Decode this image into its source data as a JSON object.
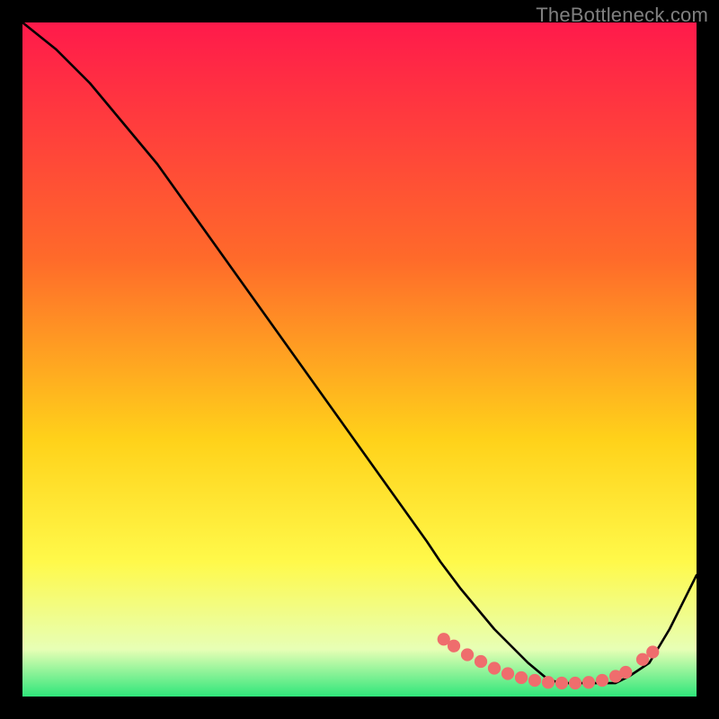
{
  "watermark": "TheBottleneck.com",
  "colors": {
    "bg_black": "#000000",
    "grad_top": "#ff1a4b",
    "grad_mid1": "#ff6a2a",
    "grad_mid2": "#ffd21a",
    "grad_mid3": "#fff94a",
    "grad_mid4": "#e7ffb5",
    "grad_bottom": "#2fe67a",
    "curve": "#000000",
    "dots": "#ef6d6d"
  },
  "chart_data": {
    "type": "line",
    "title": "",
    "xlabel": "",
    "ylabel": "",
    "xlim": [
      0,
      100
    ],
    "ylim": [
      0,
      100
    ],
    "curve": {
      "x": [
        0,
        5,
        10,
        15,
        20,
        25,
        30,
        35,
        40,
        45,
        50,
        55,
        60,
        62,
        65,
        70,
        75,
        78,
        80,
        83,
        85,
        88,
        90,
        93,
        96,
        100
      ],
      "y": [
        100,
        96,
        91,
        85,
        79,
        72,
        65,
        58,
        51,
        44,
        37,
        30,
        23,
        20,
        16,
        10,
        5,
        2.5,
        2,
        2,
        2,
        2,
        3,
        5,
        10,
        18
      ]
    },
    "highlight_dots": {
      "x": [
        62.5,
        64,
        66,
        68,
        70,
        72,
        74,
        76,
        78,
        80,
        82,
        84,
        86,
        88,
        89.5,
        92,
        93.5
      ],
      "y": [
        8.5,
        7.5,
        6.2,
        5.2,
        4.2,
        3.4,
        2.8,
        2.4,
        2.1,
        2.0,
        2.0,
        2.1,
        2.4,
        3.0,
        3.6,
        5.5,
        6.6
      ]
    }
  }
}
